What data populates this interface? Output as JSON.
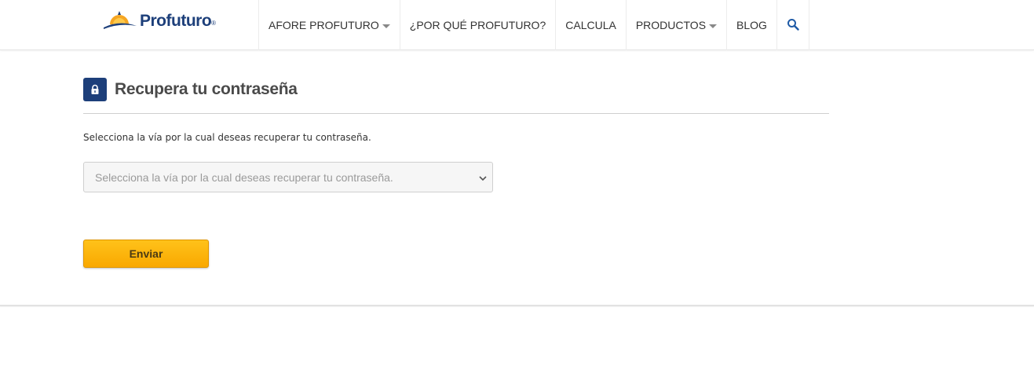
{
  "header": {
    "logo_text": "Profuturo",
    "logo_reg": "®",
    "nav": [
      {
        "label": "AFORE PROFUTURO",
        "dropdown": true
      },
      {
        "label": "¿POR QUÉ PROFUTURO?",
        "dropdown": false
      },
      {
        "label": "CALCULA",
        "dropdown": false
      },
      {
        "label": "PRODUCTOS",
        "dropdown": true
      },
      {
        "label": "BLOG",
        "dropdown": false
      }
    ],
    "search_icon": "search-icon"
  },
  "main": {
    "title": "Recupera tu contraseña",
    "title_icon": "lock-icon",
    "instructions": "Selecciona la vía por la cual deseas recuperar tu contraseña.",
    "recovery_select": {
      "selected": "Selecciona la vía por la cual deseas recuperar tu contraseña."
    },
    "submit_label": "Enviar"
  },
  "colors": {
    "brand_blue": "#1d3f7a",
    "accent_orange": "#f9a800",
    "search_blue": "#1f5aa6"
  }
}
